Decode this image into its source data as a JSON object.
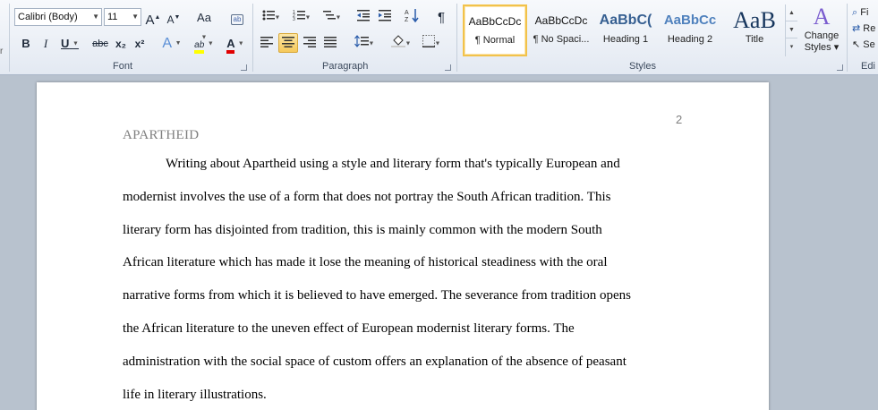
{
  "ribbon": {
    "font_group": {
      "label": "Font",
      "font_name": "Calibri (Body)",
      "font_size": "11",
      "grow_font": "A",
      "shrink_font": "A",
      "change_case": "Aa",
      "bold": "B",
      "italic": "I",
      "underline": "U",
      "strikethrough": "abc",
      "subscript": "x₂",
      "superscript": "x²",
      "text_effects": "A",
      "highlight": "ab",
      "font_color": "A"
    },
    "paragraph_group": {
      "label": "Paragraph",
      "show_marks": "¶"
    },
    "styles_group": {
      "label": "Styles",
      "styles": [
        {
          "sample": "AaBbCcDc",
          "name": "¶ Normal"
        },
        {
          "sample": "AaBbCcDc",
          "name": "¶ No Spaci..."
        },
        {
          "sample": "AaBbC(",
          "name": "Heading 1"
        },
        {
          "sample": "AaBbCc",
          "name": "Heading 2"
        },
        {
          "sample": "AaB",
          "name": "Title"
        }
      ],
      "change_styles": [
        "Change",
        "Styles ▾"
      ]
    },
    "editing_group": {
      "label": "Edi",
      "items": [
        "Fi",
        "Re",
        "Se"
      ]
    },
    "colors": {
      "highlight": "#ffff00",
      "font_color": "#e00000",
      "accent": "#f6c95b"
    }
  },
  "document": {
    "header_title": "APARTHEID",
    "page_number": "2",
    "lines": [
      "Writing about Apartheid using a style and literary form that's typically European and",
      "modernist involves the use of a form that does not portray the South African tradition. This",
      "literary form has disjointed from tradition, this is mainly common with the modern South",
      "African literature which has made it lose the meaning of historical steadiness with the oral",
      "narrative forms from which it is believed to have emerged. The severance from tradition opens",
      "the African literature to the uneven effect of European modernist literary forms. The",
      "administration with the social space of custom offers an explanation of the absence of peasant",
      "life in literary illustrations."
    ]
  }
}
